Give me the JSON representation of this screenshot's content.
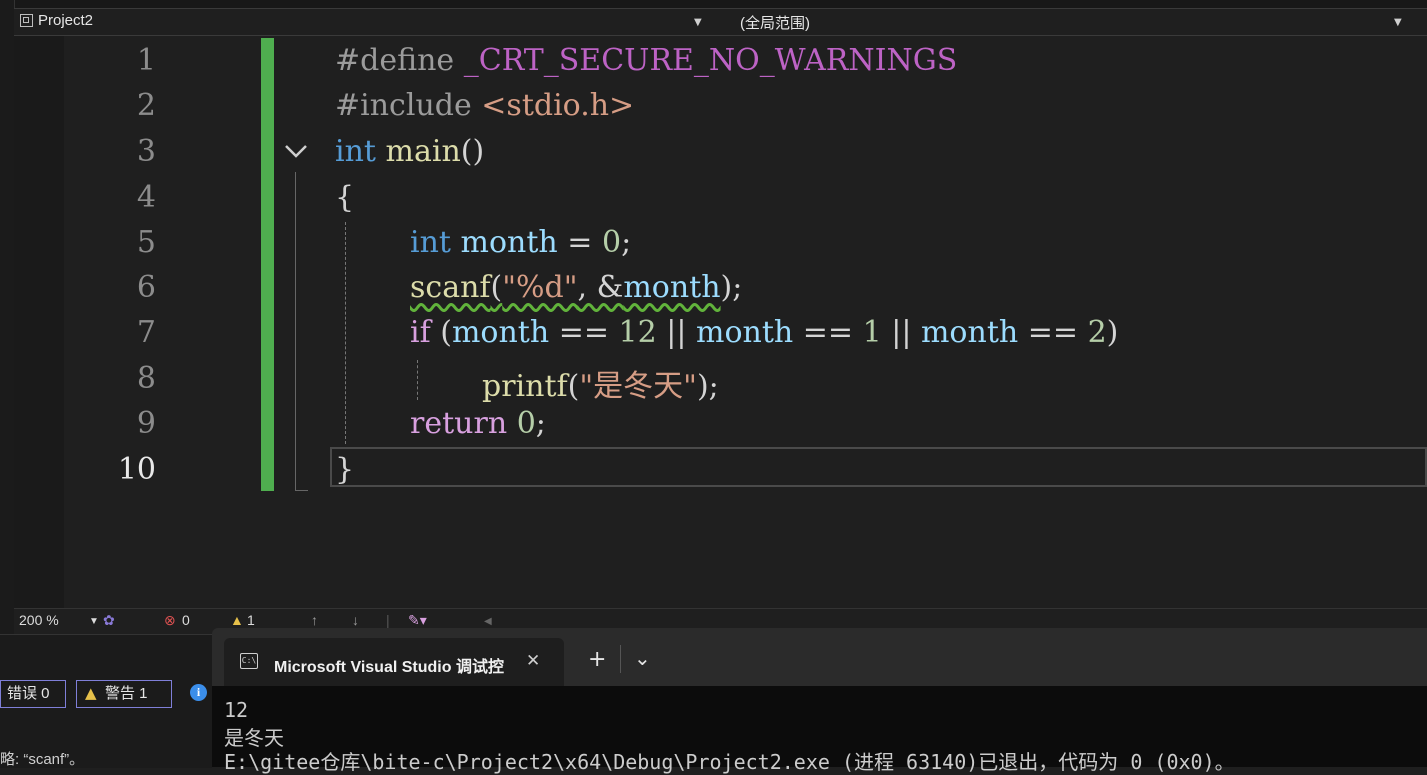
{
  "navbar": {
    "project": "Project2",
    "scope": "(全局范围)"
  },
  "editor": {
    "line_numbers": [
      "1",
      "2",
      "3",
      "4",
      "5",
      "6",
      "7",
      "8",
      "9",
      "10"
    ],
    "current_line": "10",
    "lines": {
      "l1_kw": "#define",
      "l1_macro": "_CRT_SECURE_NO_WARNINGS",
      "l2_kw": "#include",
      "l2_inc": "<stdio.h>",
      "l3_type": "int",
      "l3_fn": "main",
      "l3_paren": "()",
      "l4": "{",
      "l5_type": "int",
      "l5_var": "month",
      "l5_op": " = ",
      "l5_num": "0",
      "l5_end": ";",
      "l6_fn": "scanf",
      "l6_open": "(",
      "l6_str": "\"%d\"",
      "l6_mid": ", &",
      "l6_var": "month",
      "l6_close": ");",
      "l7_kw": "if",
      "l7_p1": " (",
      "l7_v1": "month",
      "l7_op1": " == ",
      "l7_n1": "12",
      "l7_or1": " || ",
      "l7_v2": "month",
      "l7_op2": " == ",
      "l7_n2": "1",
      "l7_or2": " || ",
      "l7_v3": "month",
      "l7_op3": " == ",
      "l7_n3": "2",
      "l7_p2": ")",
      "l8_fn": "printf",
      "l8_open": "(",
      "l8_str": "\"是冬天\"",
      "l8_close": ");",
      "l9_kw": "return",
      "l9_num": "0",
      "l9_end": ";",
      "l10": "}"
    }
  },
  "status": {
    "zoom": "200 %",
    "errors": "0",
    "warnings": "1",
    "up_arrow": "↑",
    "down_arrow": "↓"
  },
  "error_panel": {
    "errors_btn": "错误 0",
    "warnings_btn": "警告 1",
    "message": "略: “scanf”。"
  },
  "terminal": {
    "tab_title": "Microsoft Visual Studio 调试控",
    "close": "✕",
    "add": "+",
    "dropdown": "⌄",
    "output": [
      "12",
      "是冬天",
      "E:\\gitee仓库\\bite-c\\Project2\\x64\\Debug\\Project2.exe (进程 63140)已退出，代码为 0 (0x0)。"
    ]
  },
  "colors": {
    "accent_green": "#4fae4f",
    "keyword": "#569cd6",
    "function": "#dcdcaa",
    "variable": "#9cdcfe",
    "string": "#d69d85",
    "number": "#b5cea8",
    "control": "#d8a0df"
  },
  "icons": [
    "project-icon",
    "dropdown-caret-icon",
    "fold-chevron-icon",
    "error-icon",
    "warning-icon",
    "info-icon",
    "brush-icon",
    "console-icon",
    "close-icon",
    "plus-icon"
  ]
}
